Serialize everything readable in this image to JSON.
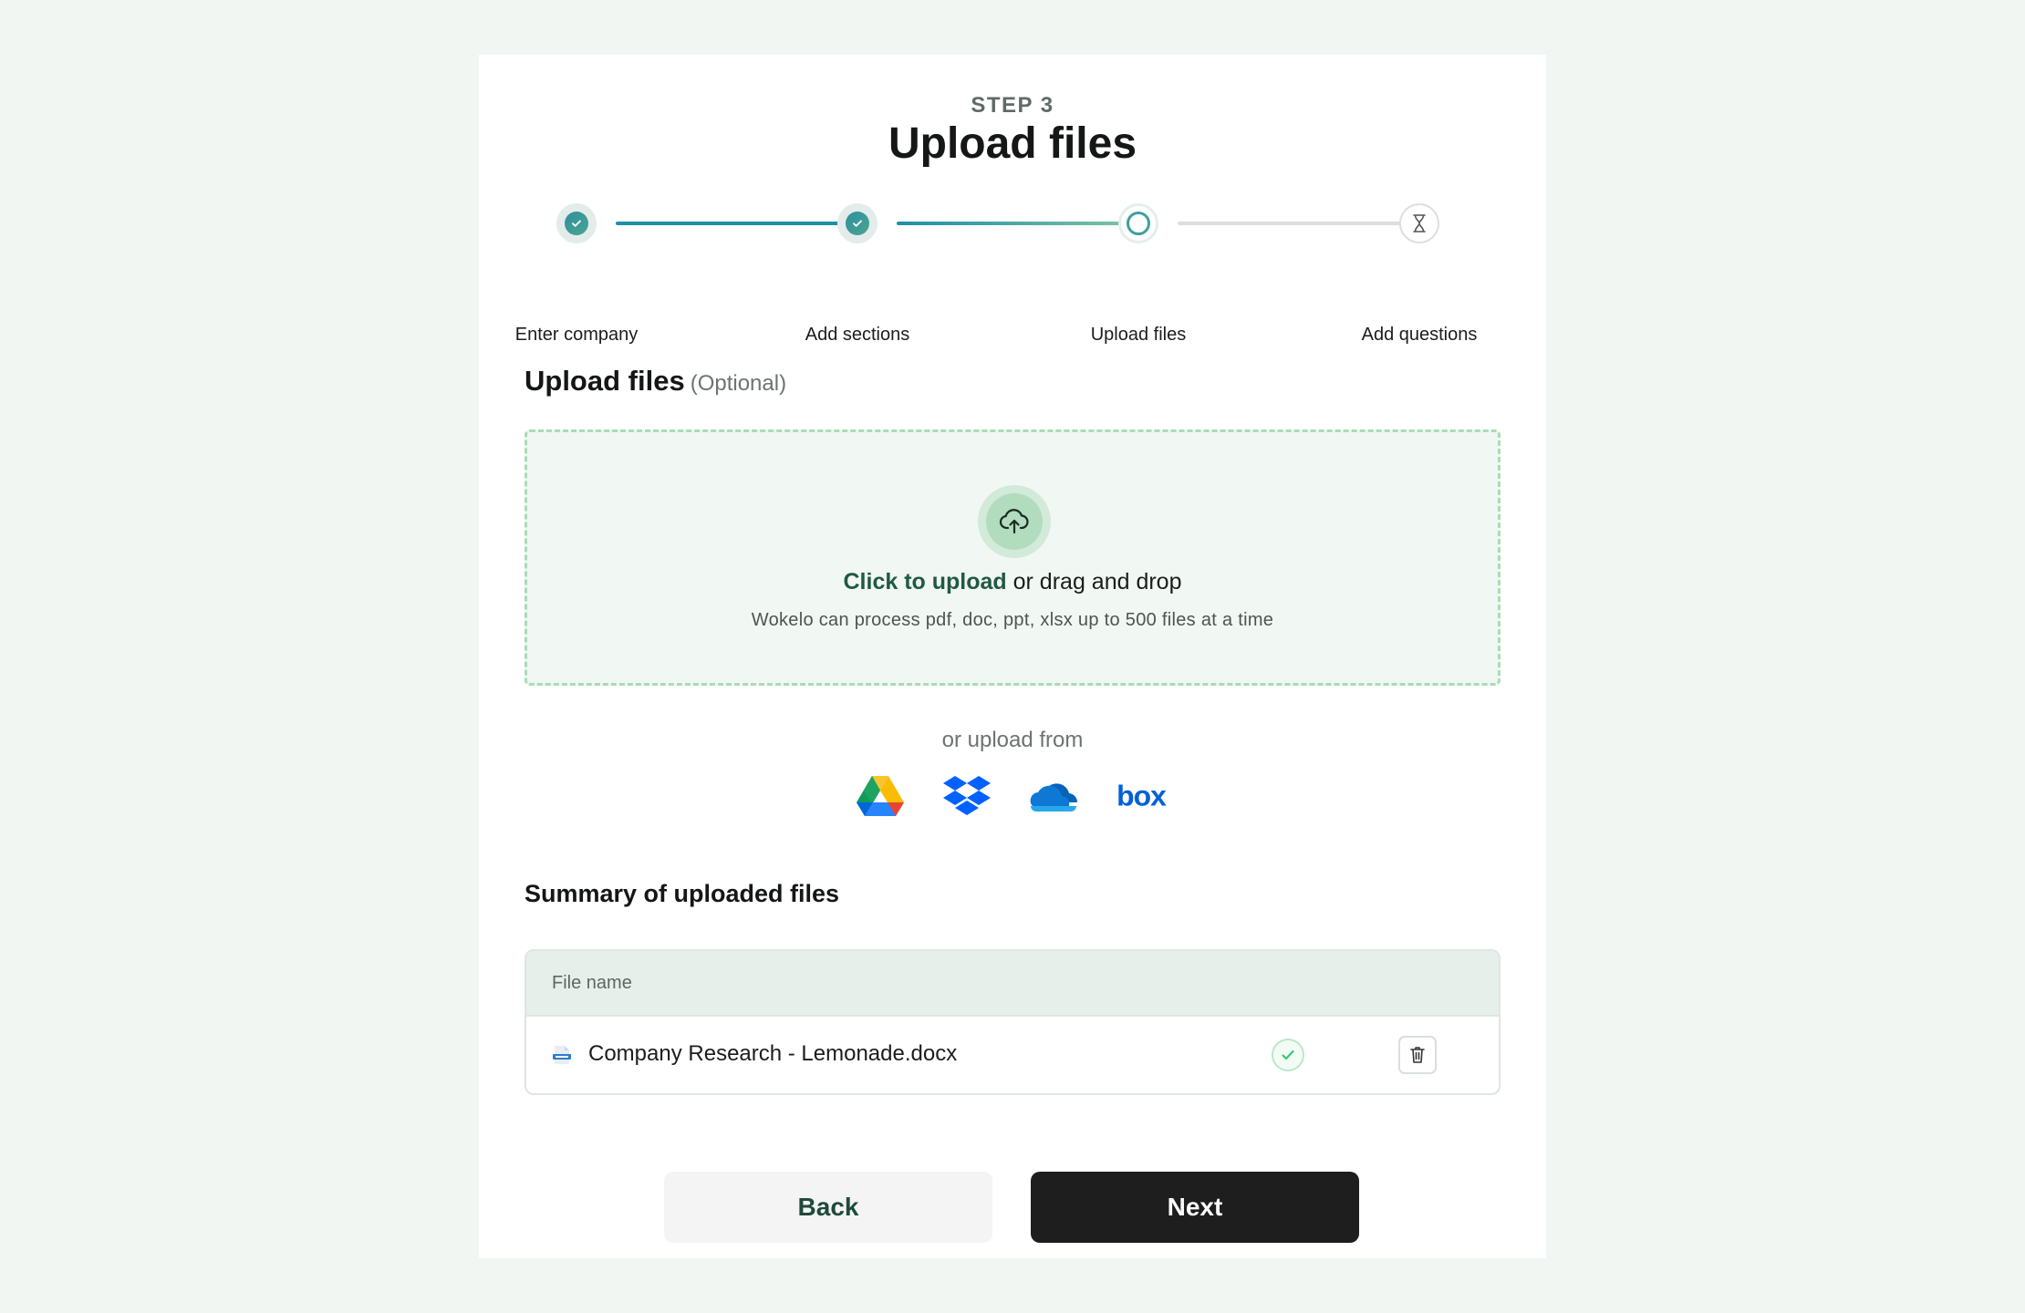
{
  "header": {
    "step_label": "STEP 3",
    "title": "Upload files"
  },
  "stepper": {
    "steps": [
      {
        "label": "Enter company",
        "state": "completed"
      },
      {
        "label": "Add sections",
        "state": "completed"
      },
      {
        "label": "Upload files",
        "state": "current"
      },
      {
        "label": "Add questions",
        "state": "pending"
      }
    ]
  },
  "upload_section": {
    "title": "Upload files",
    "optional": "(Optional)",
    "dropzone": {
      "link_text": "Click to upload",
      "rest_text": " or drag and drop",
      "hint": "Wokelo can process pdf, doc, ppt, xlsx up to 500 files at a time"
    },
    "or_upload_from": "or upload from",
    "providers": [
      "google-drive-icon",
      "dropbox-icon",
      "onedrive-icon",
      "box-icon"
    ],
    "box_wordmark": "box"
  },
  "summary": {
    "title": "Summary of uploaded files",
    "column_header": "File name",
    "files": [
      {
        "name": "Company Research - Lemonade.docx",
        "status": "uploaded"
      }
    ]
  },
  "actions": {
    "back_label": "Back",
    "next_label": "Next"
  },
  "colors": {
    "accent_teal": "#1f8fa6",
    "dropzone_border": "#a9dcb5",
    "next_button": "#1e1e1e",
    "success_green": "#2ecc71"
  }
}
